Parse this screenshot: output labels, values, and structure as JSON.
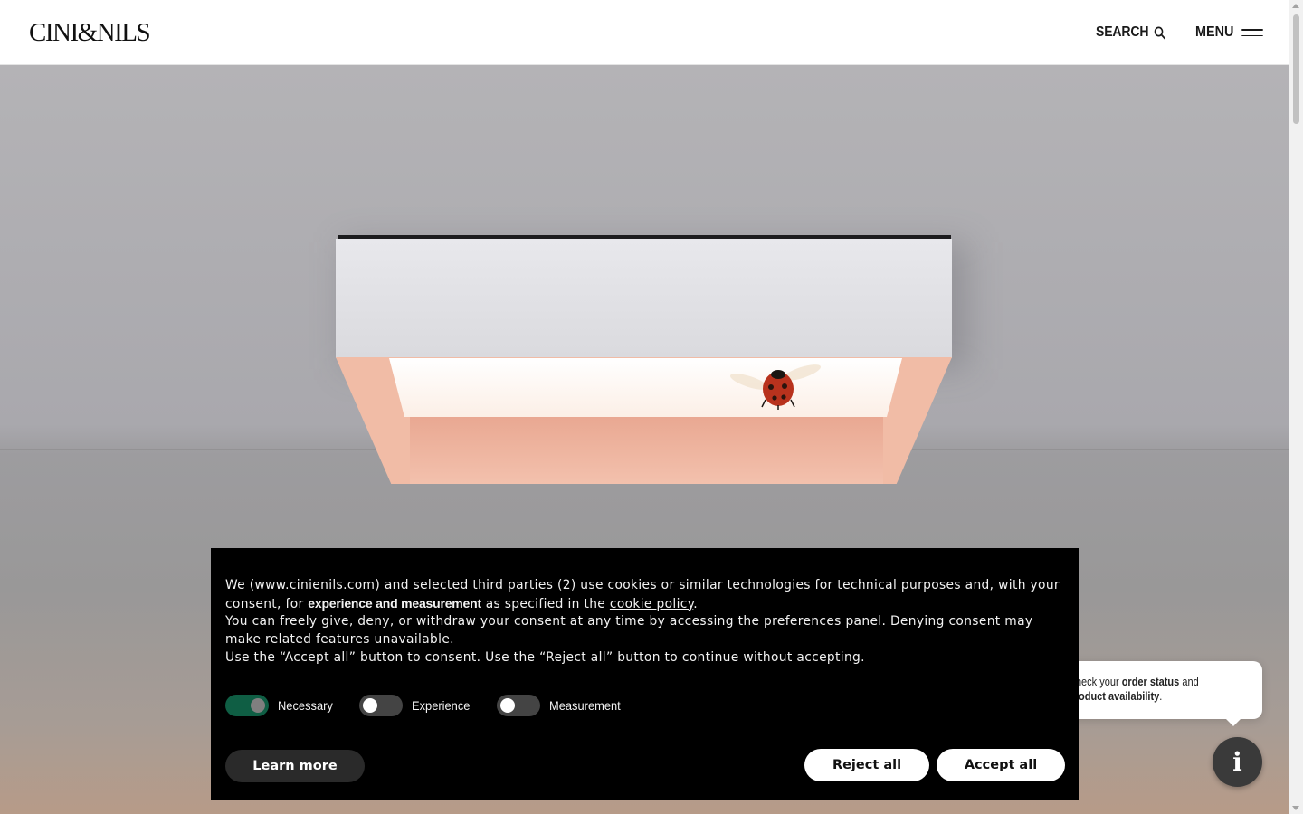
{
  "brand": {
    "logo_text": "CINI&NILS"
  },
  "header": {
    "search_label": "SEARCH",
    "menu_label": "MENU"
  },
  "hero": {
    "image_description": "ceiling lamp with ladybug"
  },
  "cookie_banner": {
    "line1_a": "We (www.cinienils.com) and selected third parties (2) use cookies or similar technologies for technical purposes and, with your consent, for ",
    "line1_strong": "experience and measurement",
    "line1_b": " as specified in the ",
    "line1_link": "cookie policy",
    "line1_c": ".",
    "line2": "You can freely give, deny, or withdraw your consent at any time by accessing the preferences panel. Denying consent may make related features unavailable.",
    "line3": "Use the “Accept all” button to consent. Use the “Reject all” button to continue without accepting.",
    "toggles": [
      {
        "label": "Necessary",
        "state": "on"
      },
      {
        "label": "Experience",
        "state": "off"
      },
      {
        "label": "Measurement",
        "state": "off"
      }
    ],
    "learn_more": "Learn more",
    "reject_all": "Reject all",
    "accept_all": "Accept all"
  },
  "info_bubble": {
    "text_a": "Check your ",
    "text_strong1": "order status",
    "text_b": " and ",
    "text_strong2": "product availability",
    "text_c": "."
  },
  "info_button": {
    "label": "i"
  },
  "colors": {
    "toggle_on": "#0f5e44",
    "banner_bg": "#000000",
    "button_bg": "#ffffff",
    "learn_more_bg": "#2a2a2a",
    "lamp_shade": "#f1bca6"
  }
}
